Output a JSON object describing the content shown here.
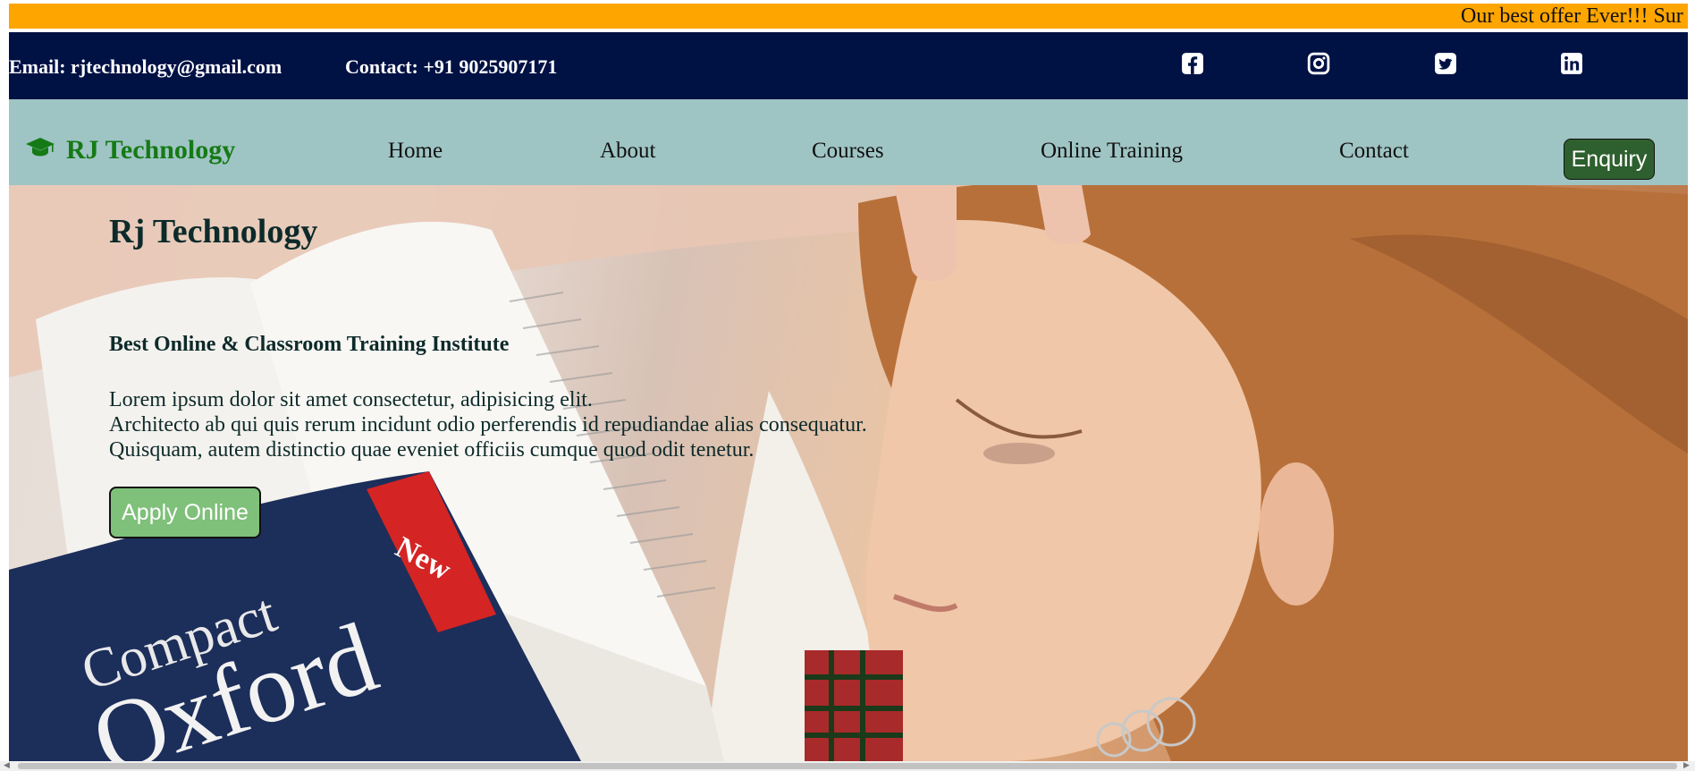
{
  "marquee": {
    "text": "Our best offer Ever!!! Sur"
  },
  "contact_bar": {
    "email": "Email: rjtechnology@gmail.com",
    "phone": "Contact: +91 9025907171",
    "social_icons": [
      "facebook-icon",
      "instagram-icon",
      "twitter-icon",
      "linkedin-icon"
    ]
  },
  "navbar": {
    "brand_icon": "graduation-cap-icon",
    "brand": "RJ Technology",
    "links": [
      "Home",
      "About",
      "Courses",
      "Online Training",
      "Contact"
    ],
    "enquiry_label": "Enquiry"
  },
  "hero": {
    "title": "Rj Technology",
    "subtitle": "Best Online & Classroom Training Institute",
    "paragraph": [
      "Lorem ipsum dolor sit amet consectetur, adipisicing elit.",
      "Architecto ab qui quis rerum incidunt odio perferendis id repudiandae alias consequatur.",
      "Quisquam, autem distinctio quae eveniet officiis cumque quod odit tenetur."
    ],
    "apply_label": "Apply Online",
    "book_cover_text": [
      "Compact",
      "Oxford",
      "New"
    ]
  },
  "colors": {
    "marquee_bg": "#ffa500",
    "contact_bg": "#001144",
    "navbar_bg": "#9fc4c4",
    "brand_green": "#157a15",
    "enquiry_bg": "#2e5f2e",
    "apply_bg": "#7fc07a"
  }
}
